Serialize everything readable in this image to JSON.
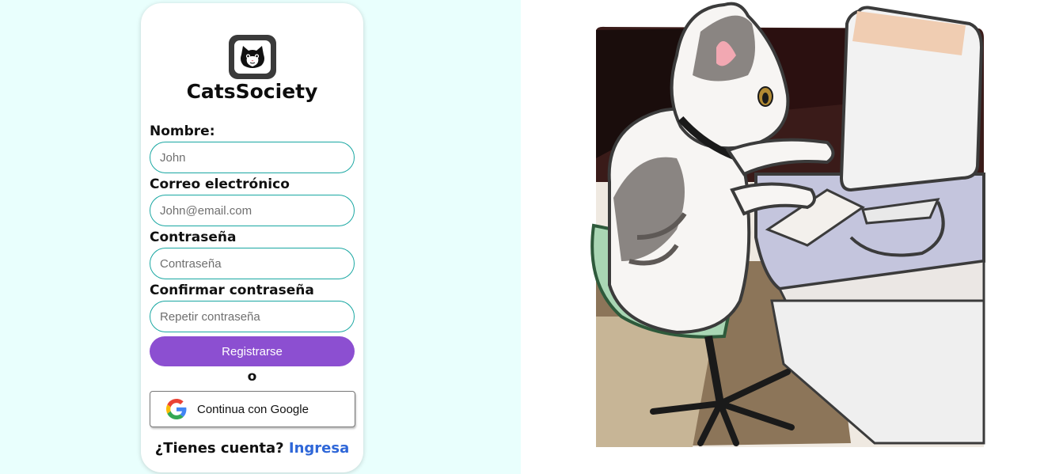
{
  "brand": {
    "name": "CatsSociety",
    "logo_icon": "cat-face-icon"
  },
  "form": {
    "fields": [
      {
        "label": "Nombre:",
        "placeholder": "John",
        "value": ""
      },
      {
        "label": "Correo electrónico",
        "placeholder": "John@email.com",
        "value": ""
      },
      {
        "label": "Contraseña",
        "placeholder": "Contraseña",
        "value": ""
      },
      {
        "label": "Confirmar contraseña",
        "placeholder": "Repetir contraseña",
        "value": ""
      }
    ],
    "submit_label": "Registrarse",
    "separator": "o",
    "google_label": "Continua con Google",
    "google_icon": "google-g-icon"
  },
  "footer": {
    "prompt": "¿Tienes cuenta?",
    "link": "Ingresa"
  },
  "illustration": {
    "subject": "cat-at-computer-illustration"
  },
  "colors": {
    "page_bg": "#e9fffd",
    "input_border": "#19a7a2",
    "primary_button": "#8c4fd1",
    "link": "#2f67d8"
  }
}
